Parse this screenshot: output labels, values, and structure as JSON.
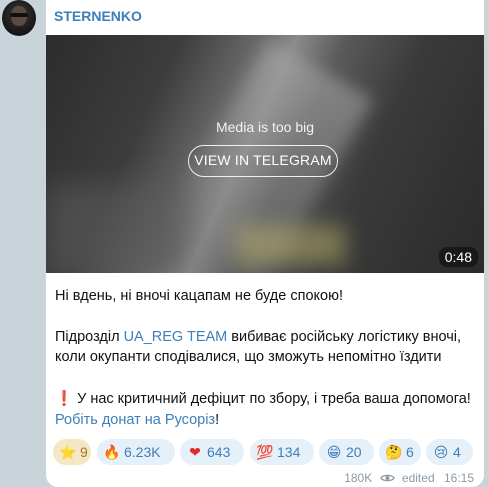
{
  "sender": "STERNENKO",
  "media": {
    "notice": "Media is too big",
    "button_label": "VIEW IN TELEGRAM",
    "duration": "0:48"
  },
  "message": {
    "line1": "Ні вдень, ні вночі кацапам не буде спокою!",
    "line2_prefix": "Підрозділ ",
    "line2_link": "UA_REG TEAM",
    "line2_suffix": " вибиває російську логістику вночі,",
    "line3": "коли окупанти сподівалися, що зможуть непомітно їздити",
    "line4_emoji": "❗",
    "line4": " У нас критичний дефіцит по збору, і треба ваша допомога!",
    "line5_link": "Робіть донат на Русоріз",
    "line5_suffix": "!"
  },
  "reactions": [
    {
      "icon": "star-icon",
      "emoji": "⭐",
      "count": "9"
    },
    {
      "icon": "fire-icon",
      "emoji": "🔥",
      "count": "6.23K"
    },
    {
      "icon": "heart-icon",
      "emoji": "❤",
      "count": "643"
    },
    {
      "icon": "hundred-icon",
      "emoji": "💯",
      "count": "134"
    },
    {
      "icon": "grin-icon",
      "emoji": "😁",
      "count": "20"
    },
    {
      "icon": "thinking-icon",
      "emoji": "🤔",
      "count": "6"
    },
    {
      "icon": "crying-icon",
      "emoji": "😢",
      "count": "4"
    }
  ],
  "meta": {
    "views": "180K",
    "edited": "edited",
    "time": "16:15"
  },
  "colors": {
    "accent": "#3d7fb8",
    "reaction_bg": "#e6f0f8",
    "chat_bg": "#c8d3da"
  }
}
